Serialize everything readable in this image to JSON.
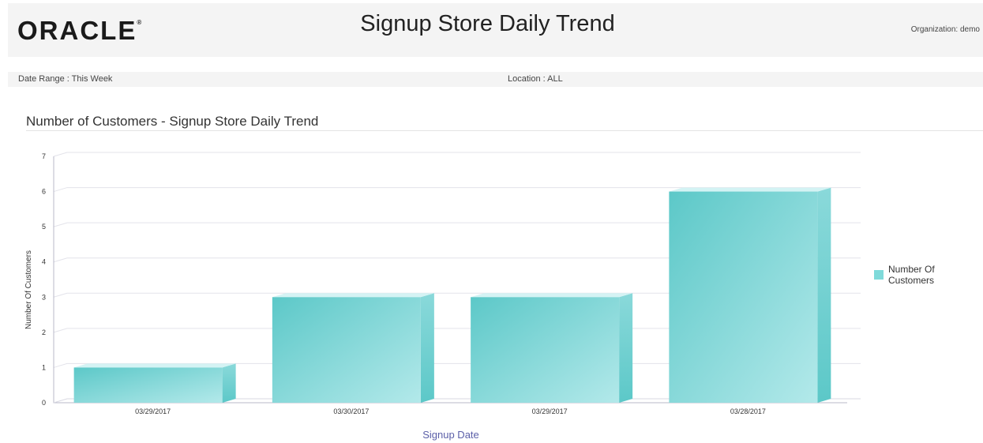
{
  "header": {
    "logo_text": "ORACLE",
    "logo_mark": "®",
    "title": "Signup Store Daily Trend",
    "organization": "Organization: demo"
  },
  "filters": {
    "date_range": "Date Range : This Week",
    "location": "Location : ALL"
  },
  "section_title": "Number of Customers - Signup Store Daily Trend",
  "colors": {
    "bar_dark": "#5cc8c8",
    "bar_light": "#b3e9ea",
    "bar_top": "#d4f3f4",
    "bar_side": "#8ad9da",
    "legend_swatch": "#7fdada"
  },
  "chart_data": {
    "type": "bar",
    "categories": [
      "03/29/2017",
      "03/30/2017",
      "03/29/2017",
      "03/28/2017"
    ],
    "series": [
      {
        "name": "Number Of Customers",
        "values": [
          1,
          3,
          3,
          6
        ]
      }
    ],
    "ylim": [
      0,
      7
    ],
    "yticks": [
      0,
      1,
      2,
      3,
      4,
      5,
      6,
      7
    ],
    "xlabel": "Signup Date",
    "ylabel": "Number Of Customers",
    "legend": {
      "position": "right",
      "labels": [
        "Number Of",
        "Customers"
      ]
    },
    "grid": true
  }
}
